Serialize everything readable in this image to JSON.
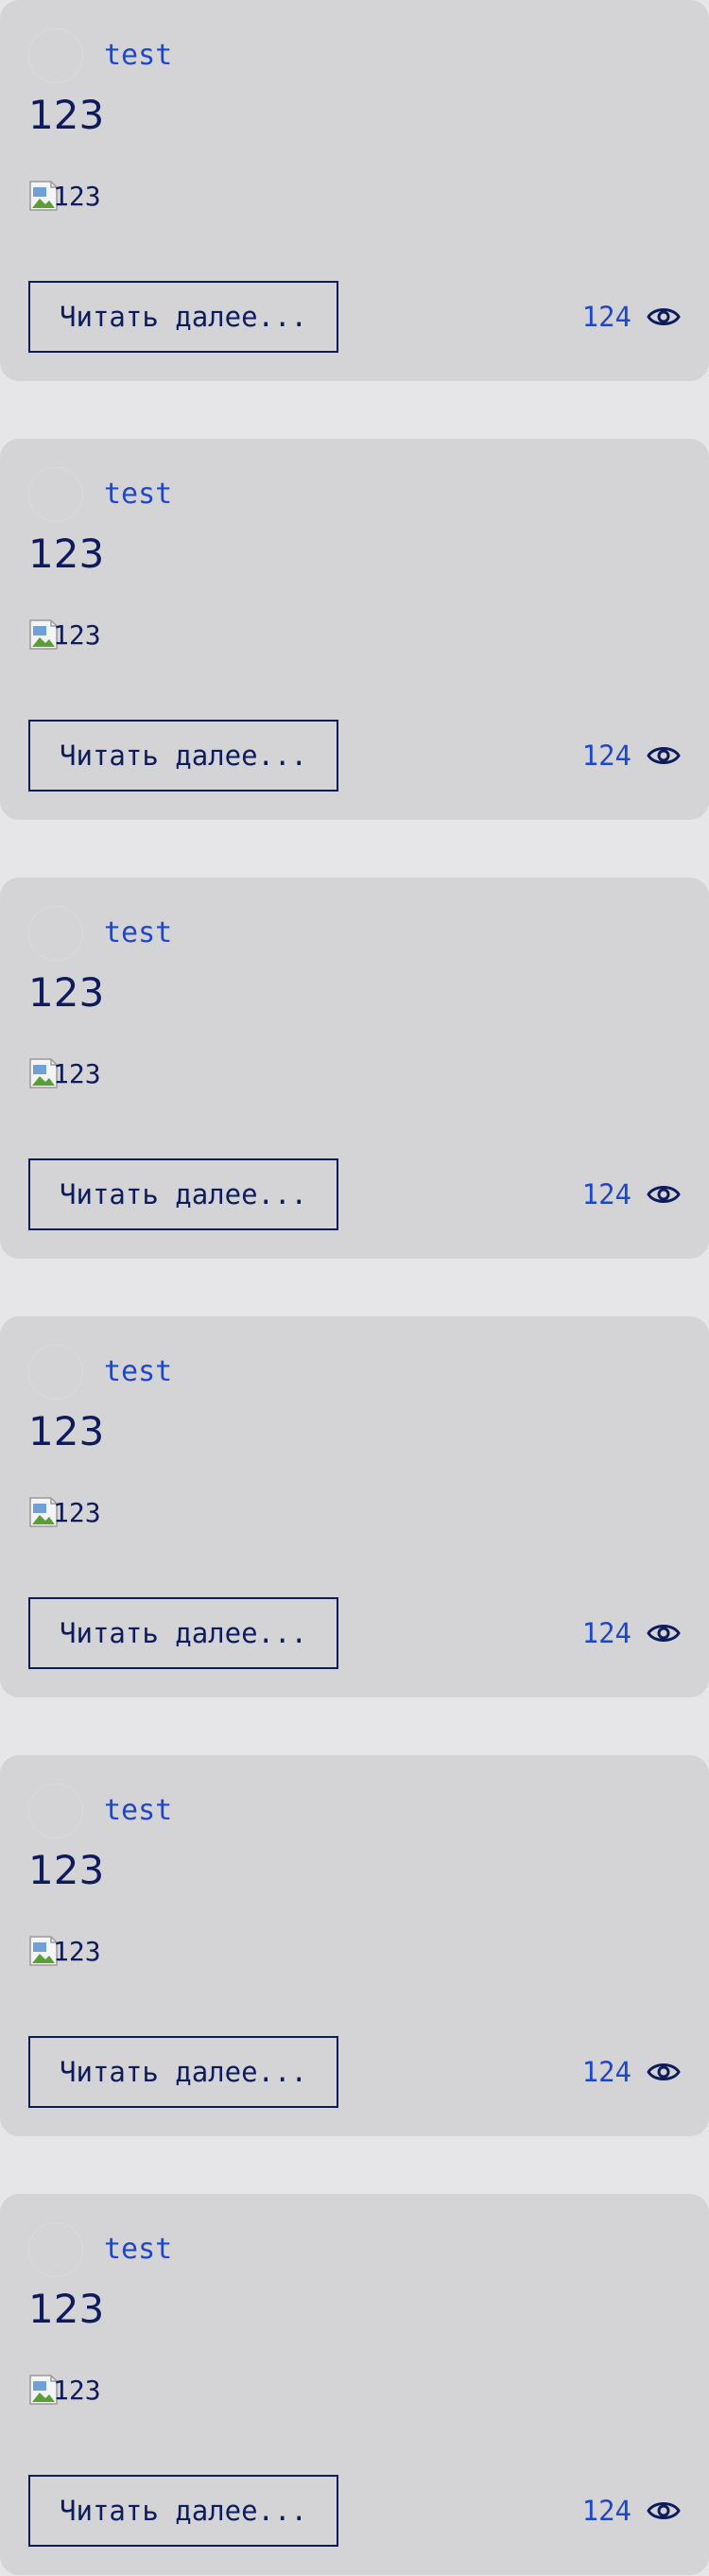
{
  "posts": [
    {
      "author": "test",
      "title": "123",
      "image_alt": "123",
      "read_more_label": "Читать далее...",
      "views": "124"
    },
    {
      "author": "test",
      "title": "123",
      "image_alt": "123",
      "read_more_label": "Читать далее...",
      "views": "124"
    },
    {
      "author": "test",
      "title": "123",
      "image_alt": "123",
      "read_more_label": "Читать далее...",
      "views": "124"
    },
    {
      "author": "test",
      "title": "123",
      "image_alt": "123",
      "read_more_label": "Читать далее...",
      "views": "124"
    },
    {
      "author": "test",
      "title": "123",
      "image_alt": "123",
      "read_more_label": "Читать далее...",
      "views": "124"
    },
    {
      "author": "test",
      "title": "123",
      "image_alt": "123",
      "read_more_label": "Читать далее...",
      "views": "124"
    }
  ],
  "icons": {
    "views": "eye-icon",
    "image_placeholder": "broken-image-icon"
  },
  "colors": {
    "page_background": "#e6e6e8",
    "card_background": "#d4d4d7",
    "primary_text": "#0e1c5c",
    "accent_text": "#1f48c8"
  }
}
